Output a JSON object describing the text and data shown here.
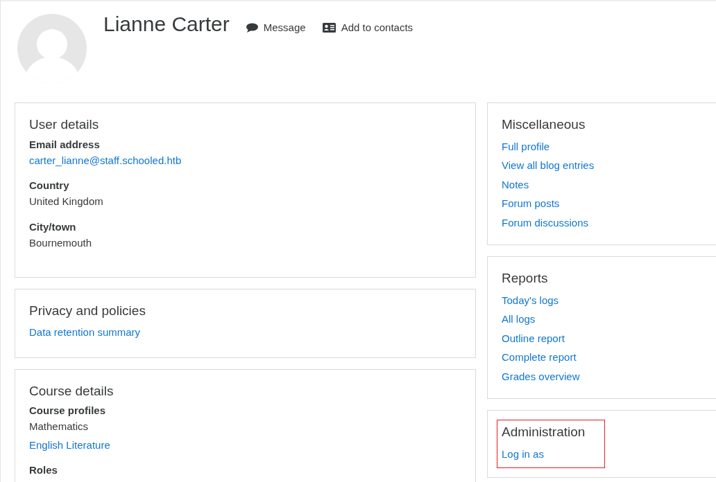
{
  "profile": {
    "name": "Lianne Carter",
    "actions": [
      {
        "kind": "message",
        "label": "Message"
      },
      {
        "kind": "contact",
        "label": "Add to contacts"
      }
    ]
  },
  "left_cards": [
    {
      "title": "User details",
      "highlighted": false,
      "sections": [
        {
          "heading": "Email address",
          "items": [
            {
              "text": "carter_lianne@staff.schooled.htb",
              "link": true
            }
          ]
        },
        {
          "heading": "Country",
          "items": [
            {
              "text": "United Kingdom",
              "link": false
            }
          ]
        },
        {
          "heading": "City/town",
          "items": [
            {
              "text": "Bournemouth",
              "link": false
            }
          ]
        }
      ]
    },
    {
      "title": "Privacy and policies",
      "highlighted": false,
      "sections": [
        {
          "items": [
            {
              "text": "Data retention summary",
              "link": true
            }
          ]
        }
      ]
    },
    {
      "title": "Course details",
      "highlighted": false,
      "sections": [
        {
          "heading": "Course profiles",
          "items": [
            {
              "text": "Mathematics",
              "link": false
            },
            {
              "text": "English Literature",
              "link": true
            }
          ]
        },
        {
          "heading": "Roles"
        }
      ]
    }
  ],
  "right_cards": [
    {
      "title": "Miscellaneous",
      "highlighted": false,
      "links": [
        "Full profile",
        "View all blog entries",
        "Notes",
        "Forum posts",
        "Forum discussions"
      ]
    },
    {
      "title": "Reports",
      "highlighted": false,
      "links": [
        "Today's logs",
        "All logs",
        "Outline report",
        "Complete report",
        "Grades overview"
      ]
    },
    {
      "title": "Administration",
      "highlighted": true,
      "links": [
        "Log in as"
      ]
    }
  ]
}
